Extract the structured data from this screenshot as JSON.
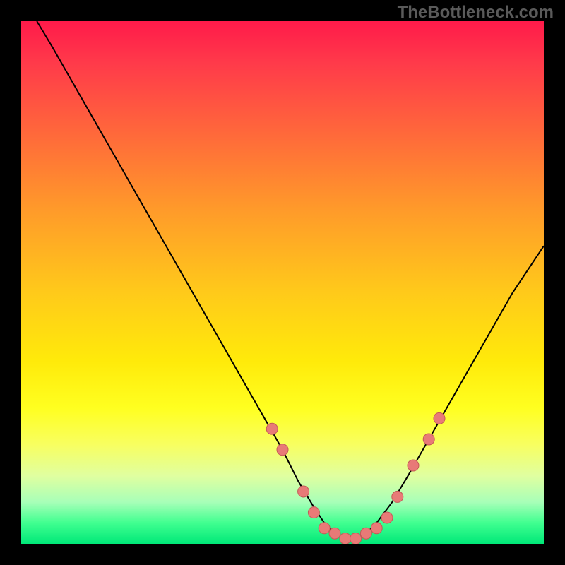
{
  "watermark": "TheBottleneck.com",
  "chart_data": {
    "type": "line",
    "title": "",
    "xlabel": "",
    "ylabel": "",
    "xlim": [
      0,
      100
    ],
    "ylim": [
      0,
      100
    ],
    "curve": {
      "x": [
        3,
        6,
        10,
        14,
        18,
        22,
        26,
        30,
        34,
        38,
        42,
        46,
        50,
        53,
        56,
        58,
        60,
        62,
        64,
        66,
        68,
        71,
        74,
        78,
        82,
        86,
        90,
        94,
        98,
        100
      ],
      "y": [
        100,
        95,
        88,
        81,
        74,
        67,
        60,
        53,
        46,
        39,
        32,
        25,
        18,
        12,
        7,
        4,
        2,
        1,
        1,
        2,
        4,
        8,
        13,
        20,
        27,
        34,
        41,
        48,
        54,
        57
      ]
    },
    "points": {
      "x": [
        48,
        50,
        54,
        56,
        58,
        60,
        62,
        64,
        66,
        68,
        70,
        72,
        75,
        78,
        80
      ],
      "y": [
        22,
        18,
        10,
        6,
        3,
        2,
        1,
        1,
        2,
        3,
        5,
        9,
        15,
        20,
        24
      ]
    },
    "colors": {
      "curve": "#000000",
      "points_fill": "#e87a77",
      "points_stroke": "#c45a57"
    }
  }
}
